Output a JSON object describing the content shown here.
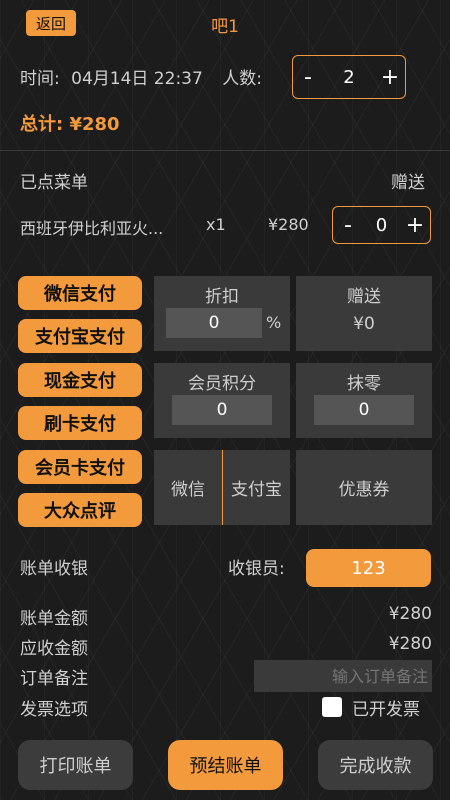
{
  "header": {
    "back_label": "返回",
    "title": "吧1"
  },
  "info": {
    "time_label": "时间:",
    "time_value": "04月14日 22:37",
    "people_label": "人数:",
    "people_minus": "-",
    "people_count": "2",
    "people_plus": "+"
  },
  "total": "总计: ¥280",
  "order": {
    "header_left": "已点菜单",
    "header_right": "赠送",
    "items": [
      {
        "name": "西班牙伊比利亚火...",
        "qty": "x1",
        "price": "¥280",
        "gift_minus": "-",
        "gift_count": "0",
        "gift_plus": "+"
      }
    ]
  },
  "payment_methods": [
    "微信支付",
    "支付宝支付",
    "现金支付",
    "刷卡支付",
    "会员卡支付",
    "大众点评"
  ],
  "panel": {
    "discount_label": "折扣",
    "discount_value": "0",
    "discount_unit": "%",
    "gift_label": "赠送",
    "gift_value": "¥0",
    "points_label": "会员积分",
    "points_value": "0",
    "round_label": "抹零",
    "round_value": "0",
    "wechat": "微信",
    "alipay": "支付宝",
    "coupon": "优惠券"
  },
  "billing": {
    "label": "账单收银",
    "cashier_label": "收银员:",
    "cashier_value": "123",
    "bill_amount_label": "账单金额",
    "bill_amount_value": "¥280",
    "receivable_label": "应收金额",
    "receivable_value": "¥280",
    "note_label": "订单备注",
    "note_placeholder": "输入订单备注",
    "invoice_label": "发票选项",
    "invoice_checkbox_label": "已开发票"
  },
  "actions": {
    "print": "打印账单",
    "presettle": "预结账单",
    "complete": "完成收款"
  },
  "colors": {
    "accent": "#f39a3c",
    "background": "#1c1c1c",
    "panel": "#3a3a3a"
  }
}
